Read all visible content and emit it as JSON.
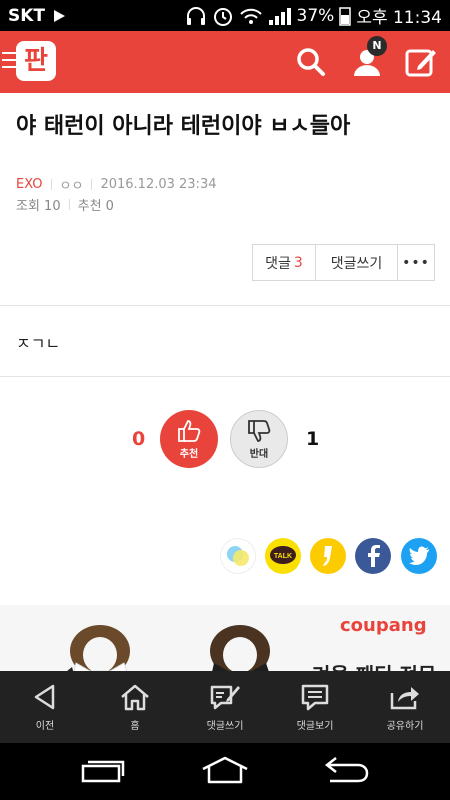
{
  "status_bar": {
    "carrier": "SKT",
    "battery": "37%",
    "time": "오후 11:34"
  },
  "app_bar": {
    "logo": "판",
    "notification_badge": "N"
  },
  "post": {
    "title": "야 태런이 아니라 테런이야 ㅂㅅ들아",
    "category": "EXO",
    "author": "ㅇㅇ",
    "date": "2016.12.03 23:34",
    "views": "조회 10",
    "recommends": "추천 0",
    "body": "ㅈㄱㄴ"
  },
  "actions": {
    "comments_label": "댓글",
    "comments_count": "3",
    "write_comment_label": "댓글쓰기",
    "more_label": "•••"
  },
  "vote": {
    "up_count": "0",
    "up_label": "추천",
    "down_count": "1",
    "down_label": "반대"
  },
  "ad": {
    "brand": "coupang",
    "text": "겨울 패딩 전문"
  },
  "bottom_bar": {
    "prev": "이전",
    "home": "홈",
    "write_comment": "댓글쓰기",
    "view_comments": "댓글보기",
    "share": "공유하기"
  },
  "colors": {
    "accent": "#e8443c",
    "kakao_yellow": "#f9e000",
    "facebook": "#3b5998",
    "twitter": "#1da1f2"
  }
}
